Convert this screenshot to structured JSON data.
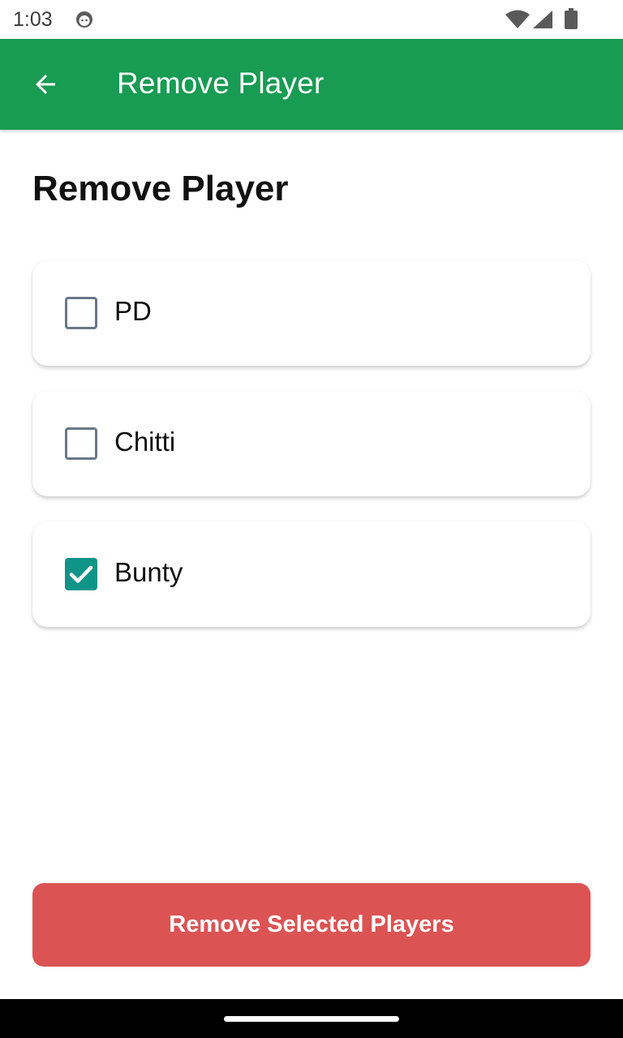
{
  "status_bar": {
    "time": "1:03",
    "icons": [
      "android-face-icon",
      "wifi-icon",
      "signal-icon",
      "battery-icon"
    ]
  },
  "app_bar": {
    "title": "Remove Player",
    "back_icon": "arrow-back-icon",
    "color": "#189b52"
  },
  "page": {
    "heading": "Remove Player"
  },
  "players": [
    {
      "name": "PD",
      "checked": false
    },
    {
      "name": "Chitti",
      "checked": false
    },
    {
      "name": "Bunty",
      "checked": true
    }
  ],
  "actions": {
    "remove_label": "Remove Selected Players",
    "remove_color": "#dc5353"
  },
  "colors": {
    "checkbox_checked": "#0f9488",
    "checkbox_unchecked_border": "#6b7787"
  }
}
